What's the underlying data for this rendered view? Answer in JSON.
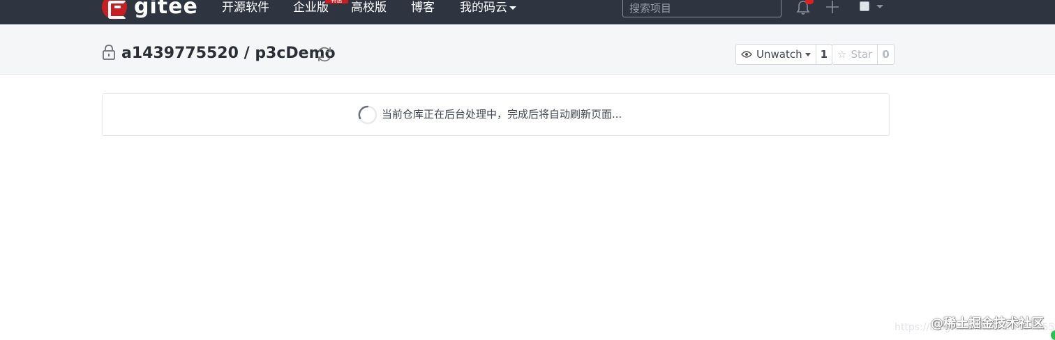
{
  "navbar": {
    "logo_text": "gitee",
    "items": [
      {
        "label": "开源软件"
      },
      {
        "label": "企业版",
        "badge": "特惠"
      },
      {
        "label": "高校版"
      },
      {
        "label": "博客"
      },
      {
        "label": "我的码云"
      }
    ],
    "search_placeholder": "搜索项目",
    "notification_count": "1",
    "icons": [
      "gitee-logo-icon",
      "bell-icon",
      "plus-icon",
      "avatar-icon",
      "caret-down-icon"
    ]
  },
  "project": {
    "owner": "a1439775520",
    "separator": "/",
    "name": "p3cDemo",
    "title": "a1439775520 / p3cDemo",
    "watch": {
      "label": "Unwatch",
      "count": "1"
    },
    "star": {
      "label": "Star",
      "count": "0"
    }
  },
  "status": {
    "message": "当前仓库正在后台处理中，完成后将自动刷新页面..."
  },
  "watermark": {
    "url": "https://blog.csdn.net/a1439775520",
    "brand": "@稀土掘金技术社区"
  },
  "colors": {
    "navbar_bg": "#2e3440",
    "brand_red": "#c71d23",
    "header_bg": "#f5f6f7"
  }
}
